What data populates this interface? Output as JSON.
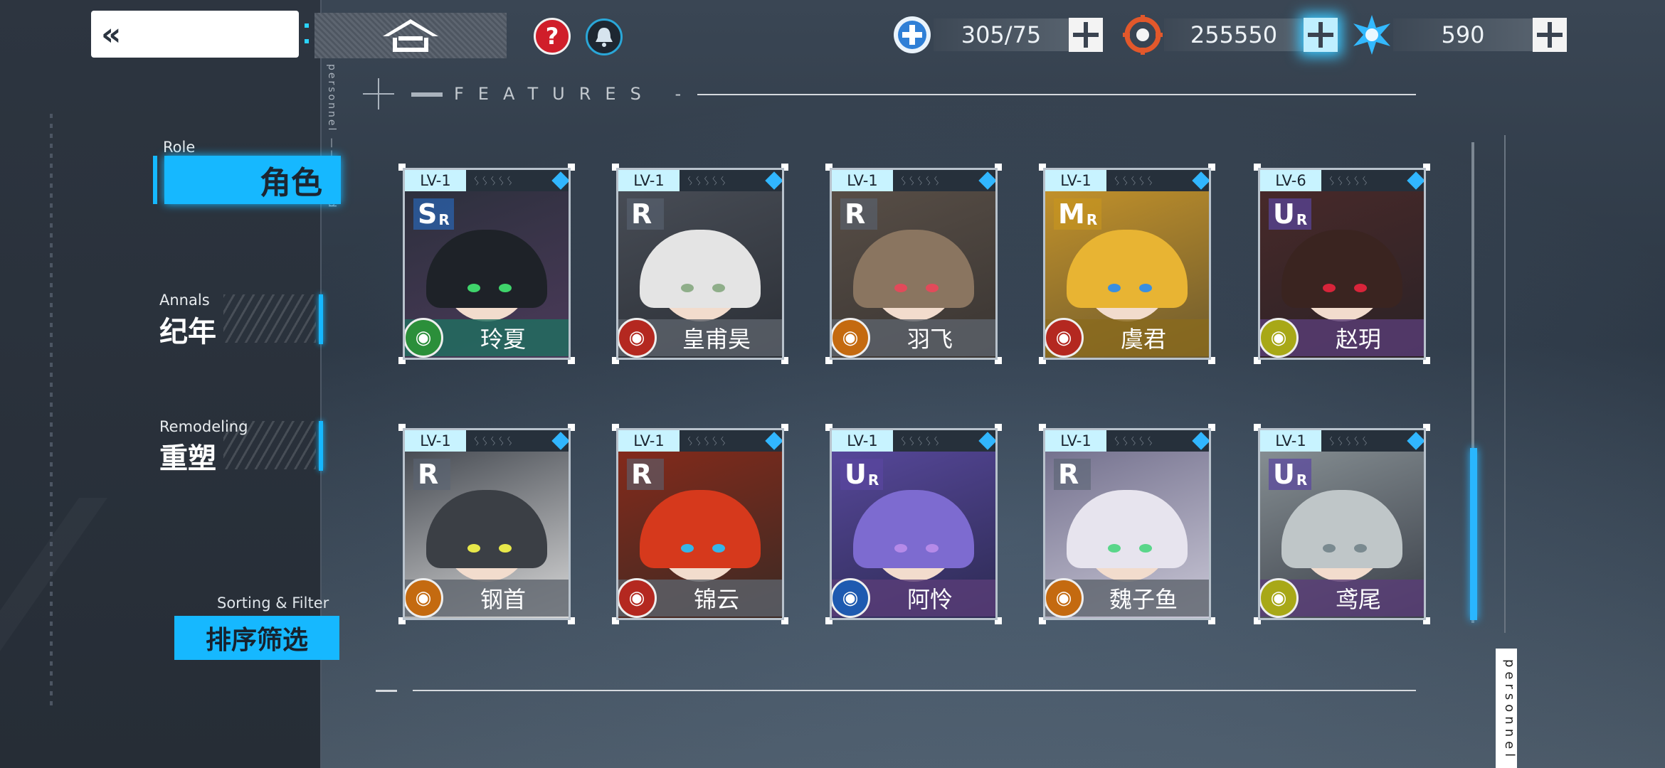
{
  "topbar": {
    "back_icon": "«",
    "resources": [
      {
        "name": "stamina",
        "value": "305/75",
        "icon": "plus-circle-icon",
        "color": "#2f7fd6"
      },
      {
        "name": "credits",
        "value": "255550",
        "icon": "target-icon",
        "color": "#e2582b"
      },
      {
        "name": "crystals",
        "value": "590",
        "icon": "burst-icon",
        "color": "#33b9ff"
      }
    ]
  },
  "features": {
    "label": "FEATURES -"
  },
  "side_text": "personnel ——— ined",
  "nav": {
    "role": {
      "en": "Role",
      "cn": "角色"
    },
    "annals": {
      "en": "Annals",
      "cn": "纪年"
    },
    "remodeling": {
      "en": "Remodeling",
      "cn": "重塑"
    },
    "sort": {
      "en": "Sorting & Filter",
      "cn": "排序筛选"
    }
  },
  "cards": [
    {
      "name": "玲夏",
      "level": "LV-1",
      "rarity": "S",
      "rarity_sub": "R",
      "element": "wind-icon",
      "elem_color": "#2b8f3a",
      "bar_color": "#1f6f60"
    },
    {
      "name": "皇甫昊",
      "level": "LV-1",
      "rarity": "R",
      "rarity_sub": "",
      "element": "fire-icon",
      "elem_color": "#b42820",
      "bar_color": "#5d636b"
    },
    {
      "name": "羽飞",
      "level": "LV-1",
      "rarity": "R",
      "rarity_sub": "",
      "element": "thunder-icon",
      "elem_color": "#c46a10",
      "bar_color": "#5d636b"
    },
    {
      "name": "虞君",
      "level": "LV-1",
      "rarity": "M",
      "rarity_sub": "R",
      "element": "fire-icon",
      "elem_color": "#b42820",
      "bar_color": "#8a6a1d"
    },
    {
      "name": "赵玥",
      "level": "LV-6",
      "rarity": "U",
      "rarity_sub": "R",
      "element": "light-icon",
      "elem_color": "#a8a817",
      "bar_color": "#5a3d78"
    },
    {
      "name": "钢首",
      "level": "LV-1",
      "rarity": "R",
      "rarity_sub": "",
      "element": "thunder-icon",
      "elem_color": "#c46a10",
      "bar_color": "#5d636b"
    },
    {
      "name": "锦云",
      "level": "LV-1",
      "rarity": "R",
      "rarity_sub": "",
      "element": "fire-icon",
      "elem_color": "#b42820",
      "bar_color": "#5d636b"
    },
    {
      "name": "阿怜",
      "level": "LV-1",
      "rarity": "U",
      "rarity_sub": "R",
      "element": "water-icon",
      "elem_color": "#1e5ab0",
      "bar_color": "#5a3d78"
    },
    {
      "name": "魏子鱼",
      "level": "LV-1",
      "rarity": "R",
      "rarity_sub": "",
      "element": "thunder-icon",
      "elem_color": "#c46a10",
      "bar_color": "#5d636b"
    },
    {
      "name": "鸢尾",
      "level": "LV-1",
      "rarity": "U",
      "rarity_sub": "R",
      "element": "light-icon",
      "elem_color": "#a8a817",
      "bar_color": "#5a3d78"
    }
  ],
  "footer_tag": "personnel"
}
